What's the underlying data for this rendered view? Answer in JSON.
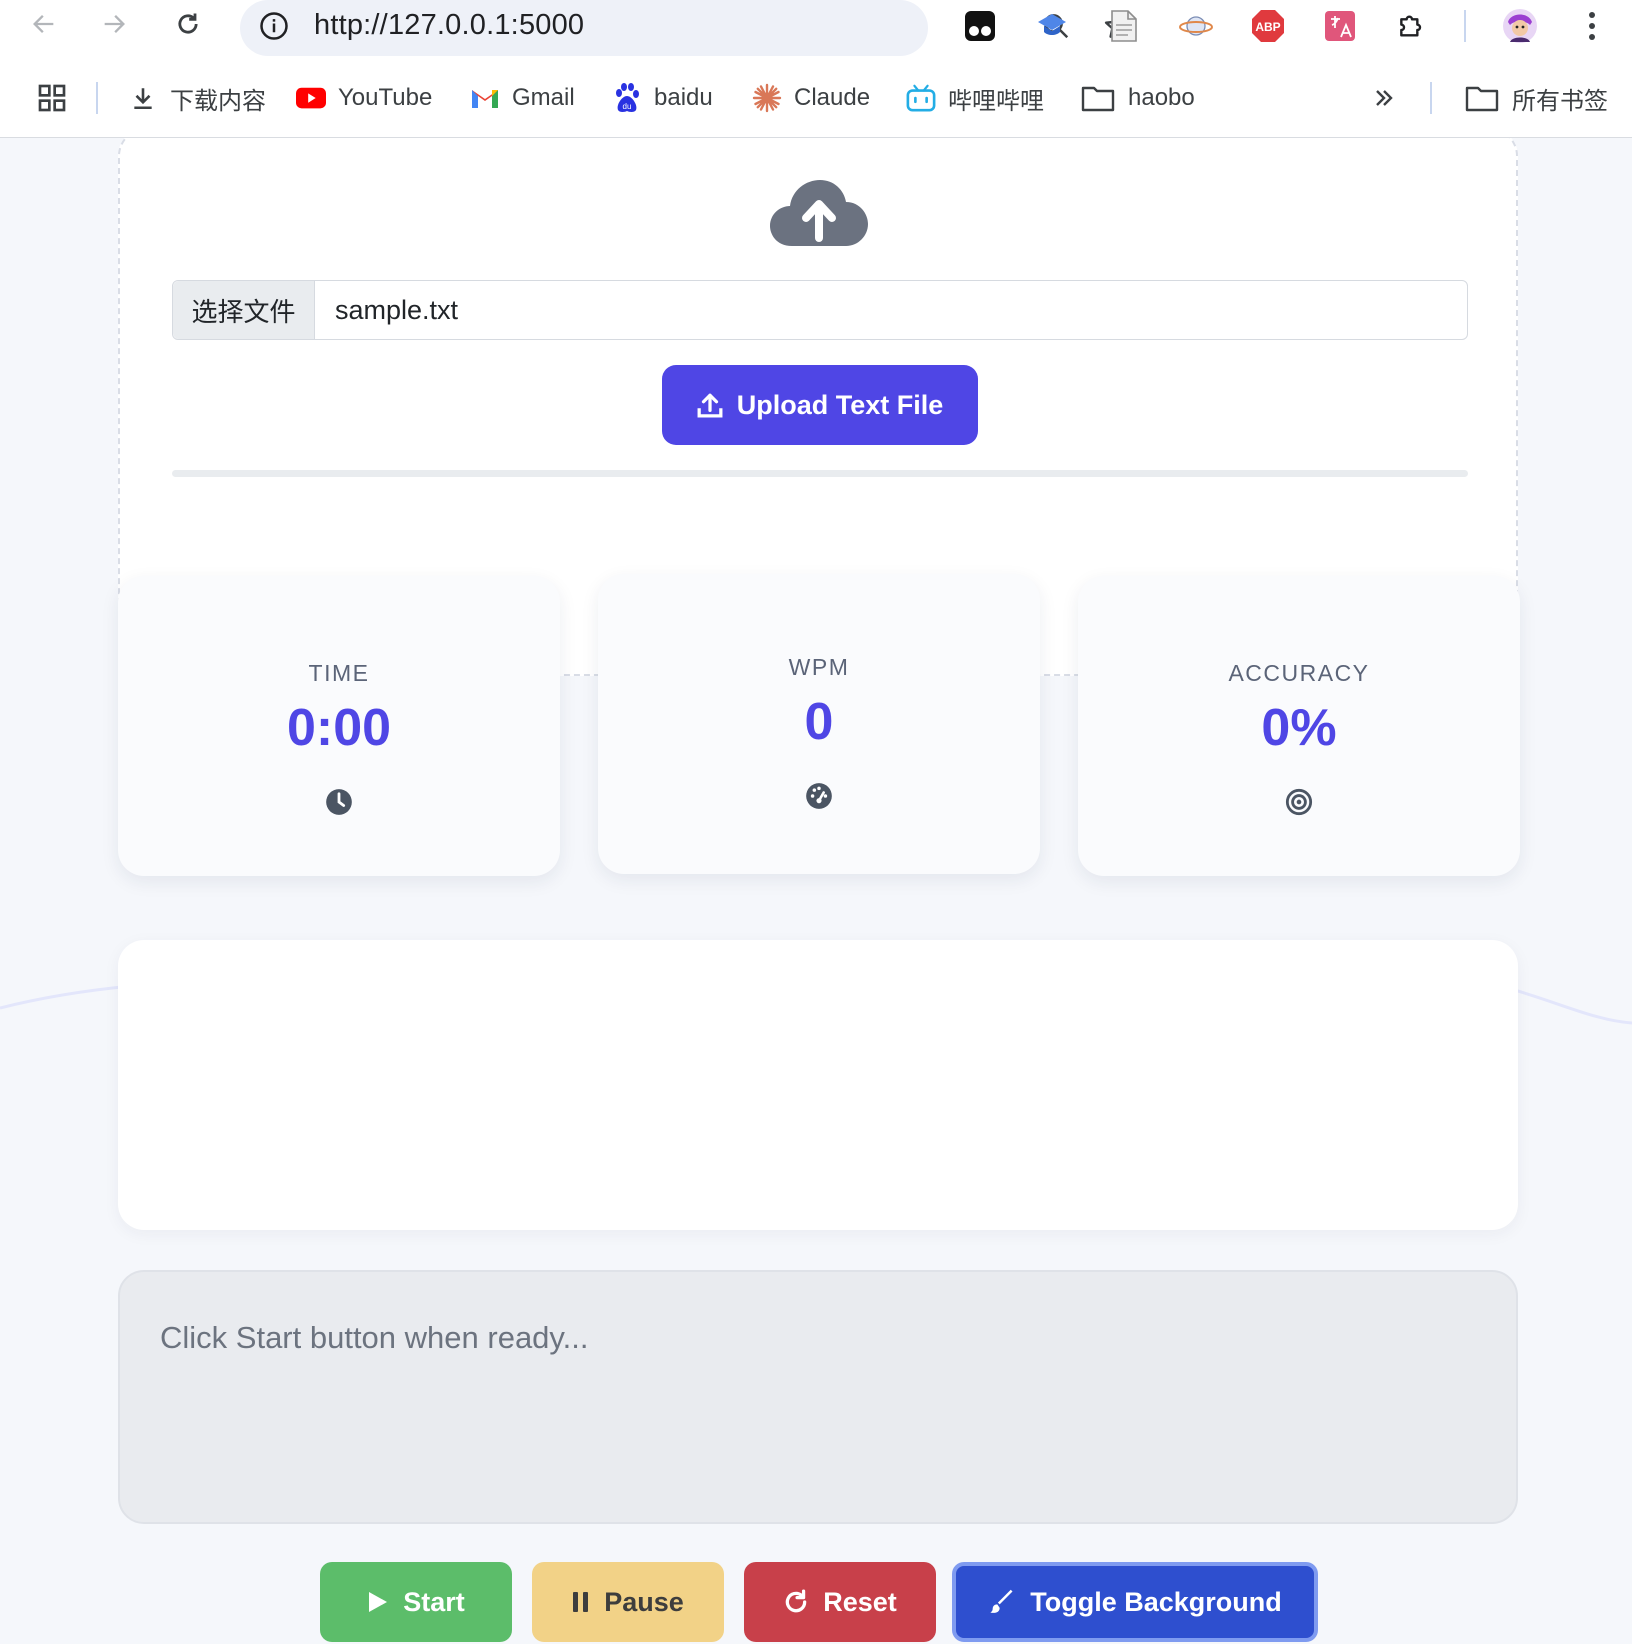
{
  "browser": {
    "url": "http://127.0.0.1:5000",
    "bookmarks": [
      {
        "label": "下载内容",
        "icon": "download-icon"
      },
      {
        "label": "YouTube",
        "icon": "youtube-icon"
      },
      {
        "label": "Gmail",
        "icon": "gmail-icon"
      },
      {
        "label": "baidu",
        "icon": "baidu-icon"
      },
      {
        "label": "Claude",
        "icon": "claude-icon"
      },
      {
        "label": "哔哩哔哩",
        "icon": "bilibili-icon"
      },
      {
        "label": "haobo",
        "icon": "folder-icon"
      }
    ],
    "all_bookmarks": "所有书签",
    "extensions": [
      "tampermonkey-icon",
      "scholar-icon",
      "document-icon",
      "planet-icon",
      "adblock-icon",
      "translate-icon",
      "puzzle-icon",
      "avatar"
    ],
    "adblock_label": "ABP"
  },
  "upload": {
    "choose_file_label": "选择文件",
    "file_name": "sample.txt",
    "upload_button_label": "Upload Text File",
    "progress_percent": 0
  },
  "stats": [
    {
      "label": "TIME",
      "value": "0:00",
      "icon": "clock-icon"
    },
    {
      "label": "WPM",
      "value": "0",
      "icon": "gauge-icon"
    },
    {
      "label": "ACCURACY",
      "value": "0%",
      "icon": "target-icon"
    }
  ],
  "typing": {
    "placeholder": "Click Start button when ready..."
  },
  "controls": {
    "start": "Start",
    "pause": "Pause",
    "reset": "Reset",
    "toggle_background": "Toggle Background"
  },
  "colors": {
    "accent": "#4f46e5",
    "start": "#5cbd6a",
    "pause": "#f2d287",
    "reset": "#c8404a",
    "toggle": "#2e4fcf"
  }
}
